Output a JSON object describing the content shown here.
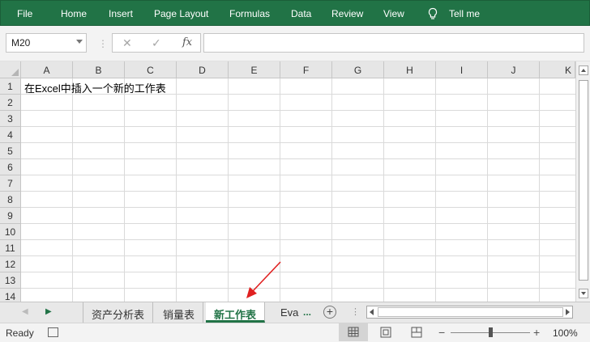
{
  "ribbon": {
    "items": [
      "File",
      "Home",
      "Insert",
      "Page Layout",
      "Formulas",
      "Data",
      "Review",
      "View"
    ],
    "tell_me": "Tell me",
    "bg_color": "#217346"
  },
  "formula_bar": {
    "name_box": "M20",
    "fx": "fx",
    "value": ""
  },
  "grid": {
    "columns": [
      "A",
      "B",
      "C",
      "D",
      "E",
      "F",
      "G",
      "H",
      "I",
      "J",
      "K"
    ],
    "rows": [
      "1",
      "2",
      "3",
      "4",
      "5",
      "6",
      "7",
      "8",
      "9",
      "10",
      "11",
      "12",
      "13",
      "14"
    ],
    "cells": {
      "A1": "在Excel中插入一个新的工作表"
    }
  },
  "sheets": {
    "tabs": [
      "资产分析表",
      "销量表",
      "新工作表",
      "Eva"
    ],
    "active": "新工作表",
    "more": "..."
  },
  "status": {
    "ready": "Ready",
    "zoom": "100%",
    "zoom_minus": "−",
    "zoom_plus": "+"
  },
  "annotation_color": "#e02020"
}
